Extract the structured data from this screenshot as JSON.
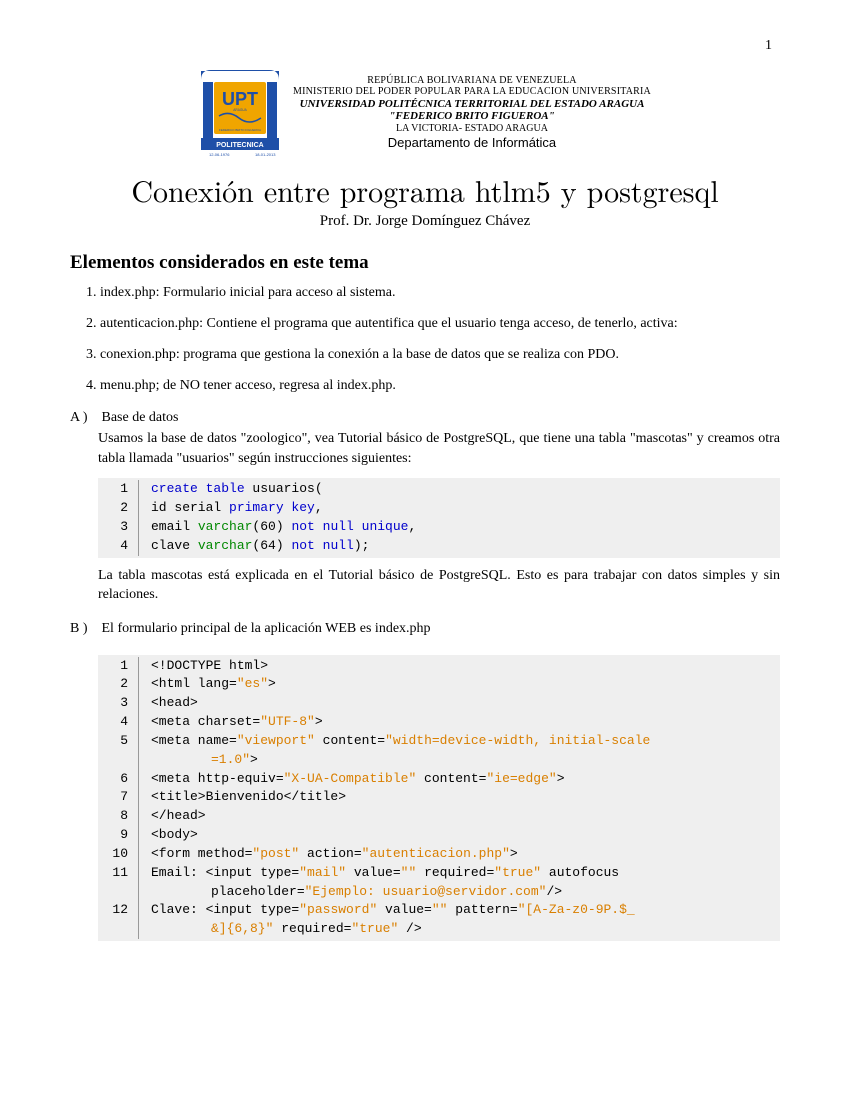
{
  "page_number": "1",
  "letterhead": {
    "line1": "REPÚBLICA BOLIVARIANA DE VENEZUELA",
    "line2": "MINISTERIO DEL PODER POPULAR PARA LA EDUCACION UNIVERSITARIA",
    "line3": "UNIVERSIDAD POLITÉCNICA TERRITORIAL DEL ESTADO ARAGUA",
    "line4": "\"FEDERICO BRITO FIGUEROA\"",
    "line5": "LA VICTORIA- ESTADO ARAGUA",
    "department": "Departamento de Informática",
    "logo_text_top": "UPT",
    "logo_text_bottom": "POLITECNICA",
    "logo_text_tagline": "FEDERICO BRITO FIGUEROA",
    "logo_text_uni": "UNIVERSIDAD",
    "logo_text_aragua": "ARAGUA"
  },
  "title": "Conexión entre programa htlm5 y postgresql",
  "author": "Prof. Dr. Jorge Domínguez Chávez",
  "section_heading": "Elementos considerados en este tema",
  "numbered": [
    "index.php: Formulario inicial para acceso al sistema.",
    "autenticacion.php: Contiene el programa que autentifica que el usuario tenga acceso, de tenerlo, activa:",
    "conexion.php: programa que gestiona la conexión a la base de datos que se realiza con PDO.",
    "menu.php; de NO tener acceso, regresa al index.php."
  ],
  "item_a": {
    "label": "A )",
    "heading": "Base de datos",
    "body": "Usamos la base de datos \"zoologico\", vea Tutorial básico de PostgreSQL, que tiene una tabla \"mascotas\" y creamos otra tabla llamada \"usuarios\" según instrucciones siguientes:"
  },
  "code_a": [
    {
      "n": "1",
      "tokens": [
        {
          "t": "create table",
          "c": "kw-blue"
        },
        {
          "t": " usuarios("
        }
      ]
    },
    {
      "n": "2",
      "tokens": [
        {
          "t": "id serial "
        },
        {
          "t": "primary key",
          "c": "kw-blue"
        },
        {
          "t": ","
        }
      ]
    },
    {
      "n": "3",
      "tokens": [
        {
          "t": "email "
        },
        {
          "t": "varchar",
          "c": "kw-green"
        },
        {
          "t": "(60) "
        },
        {
          "t": "not null unique",
          "c": "kw-blue"
        },
        {
          "t": ","
        }
      ]
    },
    {
      "n": "4",
      "tokens": [
        {
          "t": "clave "
        },
        {
          "t": "varchar",
          "c": "kw-green"
        },
        {
          "t": "(64) "
        },
        {
          "t": "not null",
          "c": "kw-blue"
        },
        {
          "t": ");"
        }
      ]
    }
  ],
  "para_after_a": "La tabla mascotas está explicada en el Tutorial básico de PostgreSQL. Esto es para trabajar con datos simples y sin relaciones.",
  "item_b": {
    "label": "B )",
    "heading": "El formulario principal de la aplicación WEB es index.php"
  },
  "code_b": [
    {
      "n": "1",
      "tokens": [
        {
          "t": "<!DOCTYPE html>"
        }
      ]
    },
    {
      "n": "2",
      "tokens": [
        {
          "t": "<html lang="
        },
        {
          "t": "\"es\"",
          "c": "kw-orange"
        },
        {
          "t": ">"
        }
      ]
    },
    {
      "n": "3",
      "tokens": [
        {
          "t": "<head>"
        }
      ]
    },
    {
      "n": "4",
      "tokens": [
        {
          "t": "<meta charset="
        },
        {
          "t": "\"UTF-8\"",
          "c": "kw-orange"
        },
        {
          "t": ">"
        }
      ]
    },
    {
      "n": "5",
      "tokens": [
        {
          "t": "<meta name="
        },
        {
          "t": "\"viewport\"",
          "c": "kw-orange"
        },
        {
          "t": " content="
        },
        {
          "t": "\"width=device-width, initial-scale",
          "c": "kw-orange"
        }
      ],
      "wrap": [
        {
          "t": "=1.0\"",
          "c": "kw-orange"
        },
        {
          "t": ">"
        }
      ]
    },
    {
      "n": "6",
      "tokens": [
        {
          "t": "<meta http-equiv="
        },
        {
          "t": "\"X-UA-Compatible\"",
          "c": "kw-orange"
        },
        {
          "t": " content="
        },
        {
          "t": "\"ie=edge\"",
          "c": "kw-orange"
        },
        {
          "t": ">"
        }
      ]
    },
    {
      "n": "7",
      "tokens": [
        {
          "t": "<title>Bienvenido</title>"
        }
      ]
    },
    {
      "n": "8",
      "tokens": [
        {
          "t": "</head>"
        }
      ]
    },
    {
      "n": "9",
      "tokens": [
        {
          "t": "<body>"
        }
      ]
    },
    {
      "n": "10",
      "tokens": [
        {
          "t": "<form method="
        },
        {
          "t": "\"post\"",
          "c": "kw-orange"
        },
        {
          "t": " action="
        },
        {
          "t": "\"autenticacion.php\"",
          "c": "kw-orange"
        },
        {
          "t": ">"
        }
      ]
    },
    {
      "n": "11",
      "tokens": [
        {
          "t": "Email: <input type="
        },
        {
          "t": "\"mail\"",
          "c": "kw-orange"
        },
        {
          "t": " value="
        },
        {
          "t": "\"\"",
          "c": "kw-orange"
        },
        {
          "t": " required="
        },
        {
          "t": "\"true\"",
          "c": "kw-orange"
        },
        {
          "t": " autofocus"
        }
      ],
      "wrap": [
        {
          "t": "placeholder="
        },
        {
          "t": "\"Ejemplo: usuario@servidor.com\"",
          "c": "kw-orange"
        },
        {
          "t": "/>"
        }
      ]
    },
    {
      "n": "12",
      "tokens": [
        {
          "t": "Clave: <input type="
        },
        {
          "t": "\"password\"",
          "c": "kw-orange"
        },
        {
          "t": " value="
        },
        {
          "t": "\"\"",
          "c": "kw-orange"
        },
        {
          "t": " pattern="
        },
        {
          "t": "\"[A-Za-z0-9P.$_",
          "c": "kw-orange"
        }
      ],
      "wrap": [
        {
          "t": "&]{6,8}\"",
          "c": "kw-orange"
        },
        {
          "t": " required="
        },
        {
          "t": "\"true\"",
          "c": "kw-orange"
        },
        {
          "t": " />"
        }
      ]
    }
  ]
}
